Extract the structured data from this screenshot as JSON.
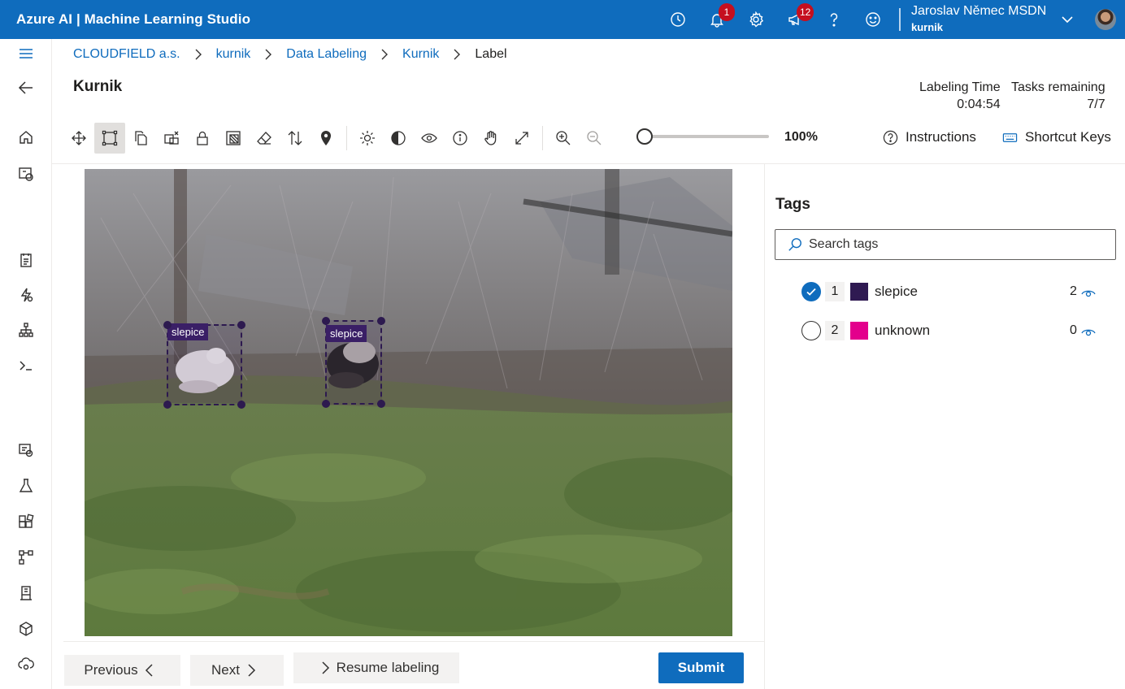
{
  "app": {
    "title": "Azure AI | Machine Learning Studio"
  },
  "topbar": {
    "notifications_badge": "1",
    "feedback_badge": "12",
    "user_name": "Jaroslav Němec MSDN",
    "workspace": "kurnik"
  },
  "breadcrumb": [
    "CLOUDFIELD a.s.",
    "kurnik",
    "Data Labeling",
    "Kurnik",
    "Label"
  ],
  "page": {
    "title": "Kurnik"
  },
  "stats": {
    "time_label": "Labeling Time",
    "time_value": "0:04:54",
    "tasks_label": "Tasks remaining",
    "tasks_value": "7/7"
  },
  "toolbar": {
    "zoom": "100%",
    "zoom_level": 0,
    "instructions": "Instructions",
    "shortcuts": "Shortcut Keys"
  },
  "annotations": [
    {
      "label": "slepice"
    },
    {
      "label": "slepice"
    }
  ],
  "buttons": {
    "previous": "Previous",
    "next": "Next",
    "resume": "Resume labeling",
    "submit": "Submit"
  },
  "tags_panel": {
    "title": "Tags",
    "search_placeholder": "Search tags",
    "tags": [
      {
        "num": "1",
        "name": "slepice",
        "count": "2",
        "color": "#2f1a52",
        "checked": true
      },
      {
        "num": "2",
        "name": "unknown",
        "count": "0",
        "color": "#e3008c",
        "checked": false
      }
    ]
  },
  "colors": {
    "accent": "#0f6cbd",
    "notification": "#c50f1f"
  }
}
